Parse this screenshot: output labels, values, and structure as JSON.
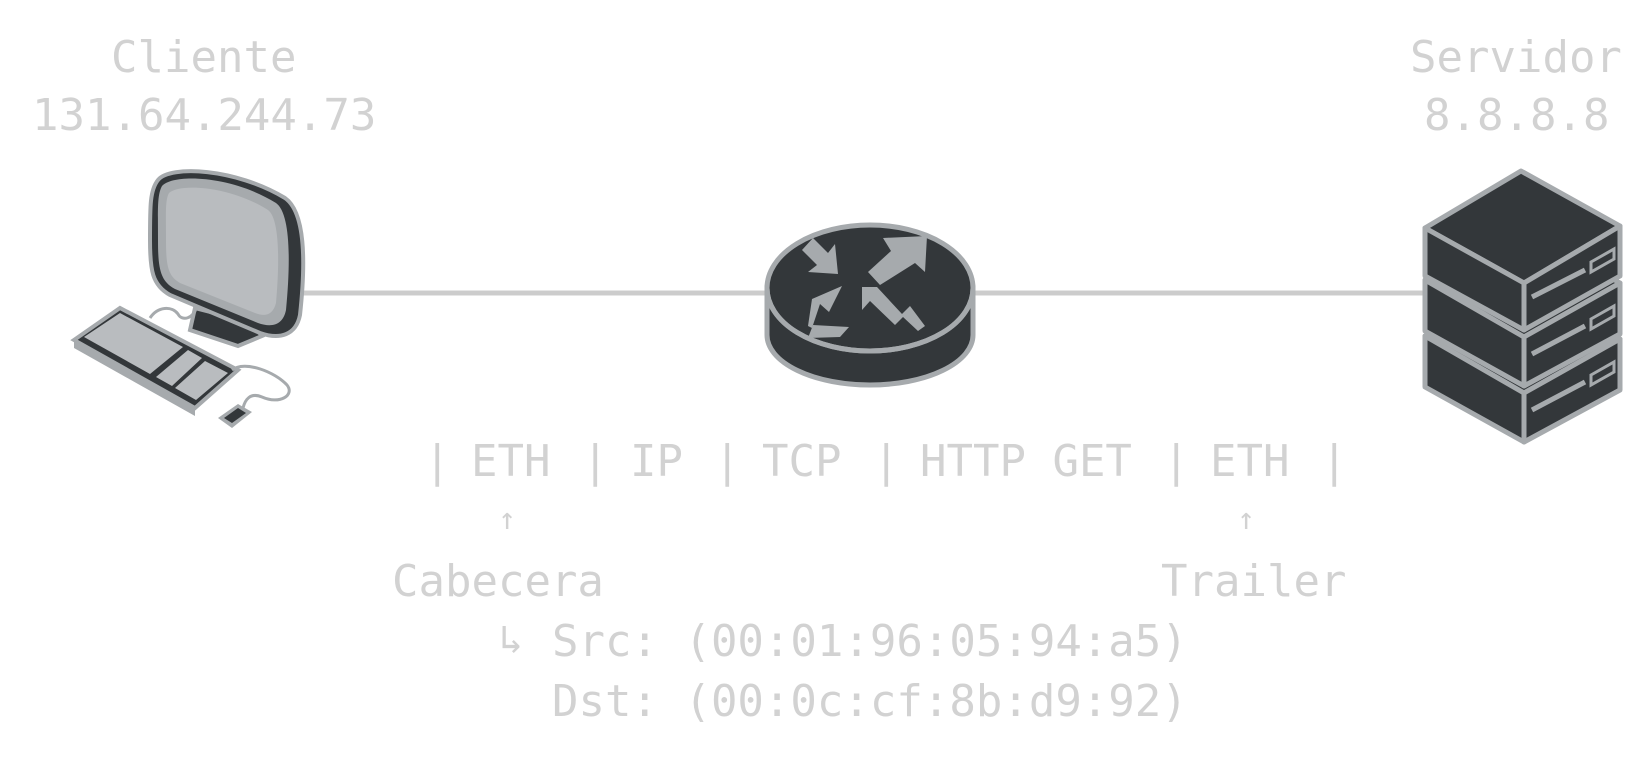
{
  "client": {
    "title": "Cliente",
    "ip": "131.64.244.73",
    "icon": "desktop-computer-icon"
  },
  "router": {
    "icon": "router-icon"
  },
  "server": {
    "title": "Servidor",
    "ip": "8.8.8.8",
    "icon": "server-stack-icon"
  },
  "frame": {
    "sep": "|",
    "fields": [
      "ETH",
      "IP",
      "TCP",
      "HTTP GET",
      "ETH"
    ]
  },
  "annotations": {
    "arrow": "↑",
    "header_label": "Cabecera",
    "trailer_label": "Trailer",
    "src_prefix": "↳",
    "src_line": "Src: (00:01:96:05:94:a5)",
    "dst_line": "Dst: (00:0c:cf:8b:d9:92)"
  },
  "colors": {
    "link": "#cccccc",
    "text": "#d2d2d2",
    "dark": "#33373a",
    "outline": "#a6aaad",
    "light": "#b9bcbf"
  }
}
